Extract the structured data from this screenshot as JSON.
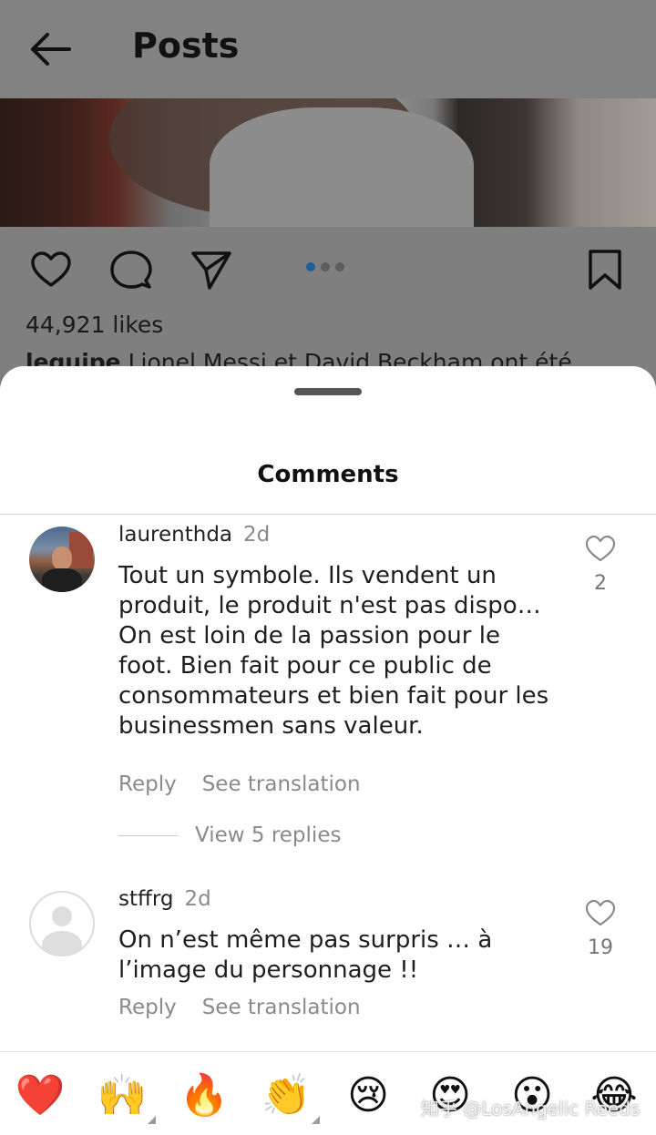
{
  "header": {
    "title": "Posts",
    "back_icon": "arrow-left-icon"
  },
  "post": {
    "likes": "44,921 likes",
    "caption_user": "lequipe",
    "caption_text": "Lionel Messi et David Beckham ont été",
    "actions": [
      "heart-icon",
      "comment-icon",
      "share-icon",
      "bookmark-icon"
    ],
    "carousel_index": 1,
    "carousel_total": 3
  },
  "sheet": {
    "title": "Comments",
    "comments": [
      {
        "username": "laurenthda",
        "time": "2d",
        "lines": [
          "Tout un symbole. Ils vendent un",
          "produit, le produit n'est pas dispo…",
          "On est loin de la passion pour le",
          "foot. Bien fait pour ce public de",
          "consommateurs et bien fait pour les",
          "businessmen sans valeur."
        ],
        "reply": "Reply",
        "translate": "See translation",
        "likes": "2",
        "view_replies": "View 5 replies"
      },
      {
        "username": "stffrg",
        "time": "2d",
        "lines": [
          "On n’est même pas surpris … à",
          "l’image du personnage !!"
        ],
        "reply": "Reply",
        "translate": "See translation",
        "likes": "19"
      }
    ]
  },
  "emoji_bar": {
    "emojis": [
      "❤️",
      "🙌",
      "🔥",
      "👏",
      "😢",
      "😍",
      "😮",
      "😂"
    ],
    "watermark": "知乎 @LosAngelic Reeds"
  },
  "colors": {
    "accent": "#1f5e93",
    "heart_red": "#e8252e",
    "muted": "#8a8a8a"
  }
}
